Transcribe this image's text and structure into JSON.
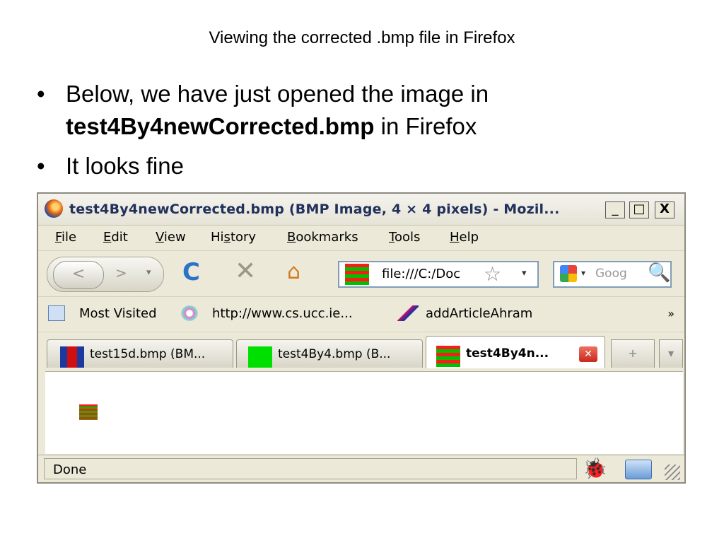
{
  "slide": {
    "title": "Viewing the corrected .bmp file in Firefox",
    "bullets": {
      "b1_lead": " Below, we have just opened the image in",
      "b1_bold": "test4By4newCorrected.bmp",
      "b1_tail": " in Firefox",
      "b2": "It looks fine",
      "marker": "•"
    }
  },
  "browser": {
    "title": "test4By4newCorrected.bmp (BMP Image, 4 × 4 pixels) - Mozil...",
    "window_buttons": {
      "minimize": "_",
      "maximize": "□",
      "close": "X"
    },
    "menu": [
      {
        "key": "F",
        "rest": "ile"
      },
      {
        "key": "E",
        "rest": "dit"
      },
      {
        "key": "V",
        "rest": "iew"
      },
      {
        "pre": "Hi",
        "key": "s",
        "rest": "tory"
      },
      {
        "key": "B",
        "rest": "ookmarks"
      },
      {
        "key": "T",
        "rest": "ools"
      },
      {
        "key": "H",
        "rest": "elp"
      }
    ],
    "nav": {
      "back": "<",
      "forward": ">",
      "reload": "C",
      "stop": "✕",
      "home": "⌂",
      "url": "file:///C:/Doc",
      "star": "☆",
      "dropdown": "▾",
      "search_placeholder": "Goog",
      "magnifier": "🔍"
    },
    "bookmarks": {
      "items": [
        "Most Visited",
        "http://www.cs.ucc.ie...",
        "addArticleAhram"
      ],
      "chevron": "»"
    },
    "tabs": [
      {
        "label": "test15d.bmp (BM..."
      },
      {
        "label": "test4By4.bmp (B..."
      },
      {
        "label": "test4By4n...",
        "active": true
      }
    ],
    "tab_close": "✕",
    "tab_new": "+",
    "tab_list": "▾",
    "status": "Done",
    "status_bug": "🐞"
  },
  "colors": {
    "bmp_red": "#ff1a1a",
    "bmp_green": "#00c000",
    "window_bg": "#ece9d8"
  }
}
